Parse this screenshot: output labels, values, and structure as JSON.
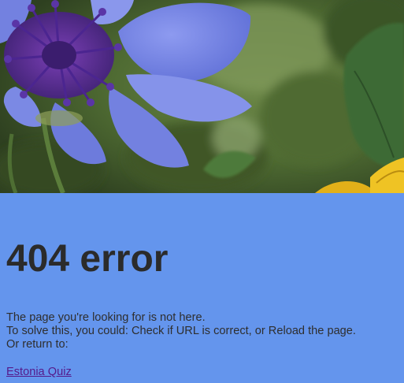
{
  "hero": {
    "image_name": "cornflower-photo",
    "colors": {
      "foliage_dark": "#3d5228",
      "foliage_mid": "#5f7a3e",
      "petal": "#7a88e6",
      "petal_dark": "#5a3fb0",
      "center": "#4a2a8a",
      "yellow_petal": "#e8b81a"
    }
  },
  "error": {
    "heading": "404 error",
    "line1": "The page you're looking for is not here.",
    "line2": "To solve this, you could: Check if URL is correct, or Reload the page.",
    "line3": "Or return to:",
    "link_label": "Estonia Quiz"
  },
  "colors": {
    "background": "#6495ED",
    "text": "#2e2e2e",
    "link_visited": "#551A8B"
  }
}
